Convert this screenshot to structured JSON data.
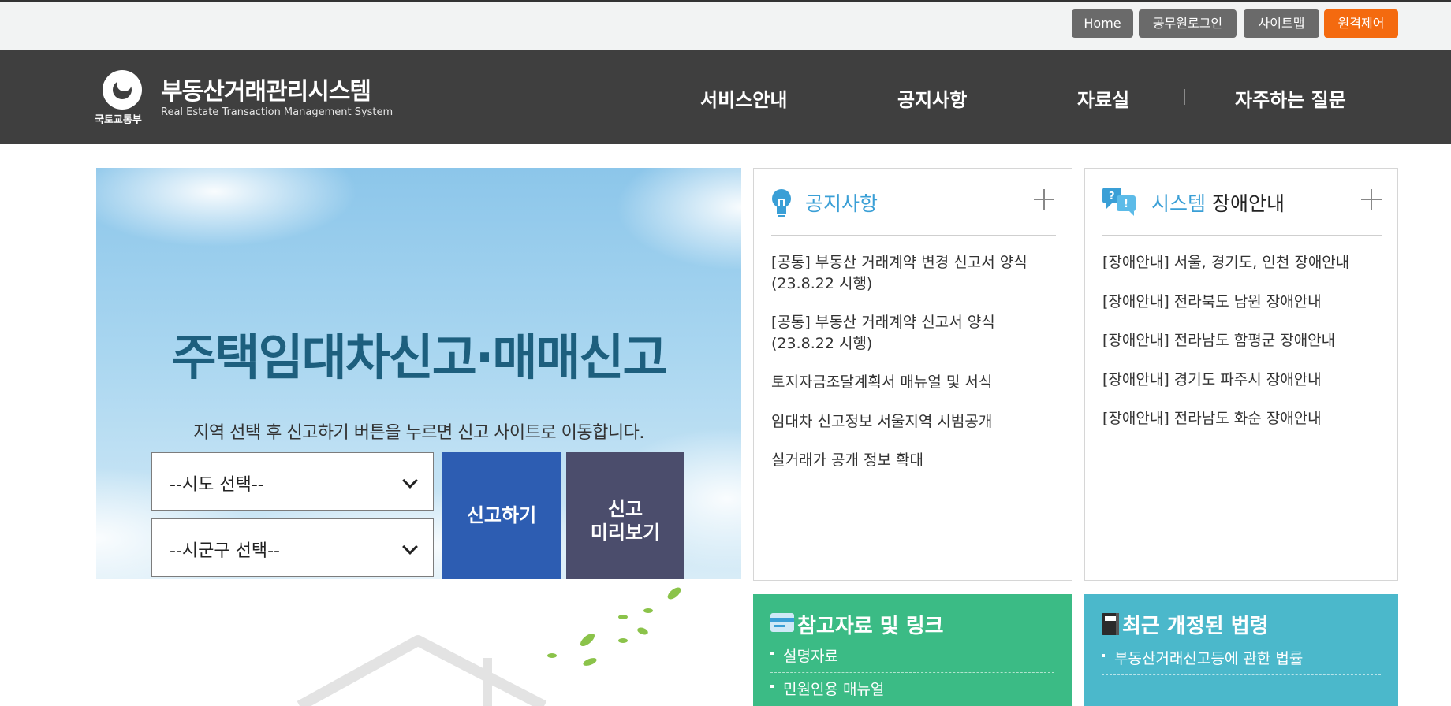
{
  "util_nav": {
    "home": "Home",
    "official_login": "공무원로그인",
    "sitemap": "사이트맵",
    "remote_control": "원격제어"
  },
  "header": {
    "ministry": "국토교통부",
    "title": "부동산거래관리시스템",
    "subtitle": "Real Estate Transaction Management System",
    "menu": [
      "서비스안내",
      "공지사항",
      "자료실",
      "자주하는 질문"
    ]
  },
  "hero": {
    "title": "주택임대차신고·매매신고",
    "description": "지역 선택 후 신고하기 버튼을 누르면 신고 사이트로 이동합니다.",
    "sido_select": "--시도 선택--",
    "sigungu_select": "--시군구 선택--",
    "report_button": "신고하기",
    "preview_button_line1": "신고",
    "preview_button_line2": "미리보기"
  },
  "notice": {
    "title": "공지사항",
    "items": [
      {
        "line1": "[공통] 부동산 거래계약 변경 신고서 양식",
        "line2": "(23.8.22 시행)"
      },
      {
        "line1": "[공통] 부동산 거래계약 신고서 양식",
        "line2": "(23.8.22 시행)"
      },
      {
        "line1": "토지자금조달계획서 매뉴얼 및 서식"
      },
      {
        "line1": "임대차 신고정보 서울지역 시범공개"
      },
      {
        "line1": "실거래가 공개 정보 확대"
      }
    ]
  },
  "outage": {
    "title_accent": "시스템",
    "title_rest": "장애안내",
    "items": [
      "[장애안내] 서울, 경기도, 인천 장애안내",
      "[장애안내] 전라북도 남원 장애안내",
      "[장애안내] 전라남도 함평군 장애안내",
      "[장애안내] 경기도 파주시 장애안내",
      "[장애안내] 전라남도 화순 장애안내"
    ]
  },
  "references": {
    "title": "참고자료 및 링크",
    "items": [
      "설명자료",
      "민원인용 매뉴얼"
    ]
  },
  "laws": {
    "title": "최근 개정된 법령",
    "items": [
      "부동산거래신고등에 관한 법률"
    ]
  },
  "colors": {
    "header_bg": "#3f3f3f",
    "accent_blue": "#3a9fd6",
    "report_blue": "#2d5db2",
    "preview_navy": "#4b4d6c",
    "green": "#3bbb85",
    "teal": "#4bb8cb",
    "orange": "#f46a0f"
  }
}
